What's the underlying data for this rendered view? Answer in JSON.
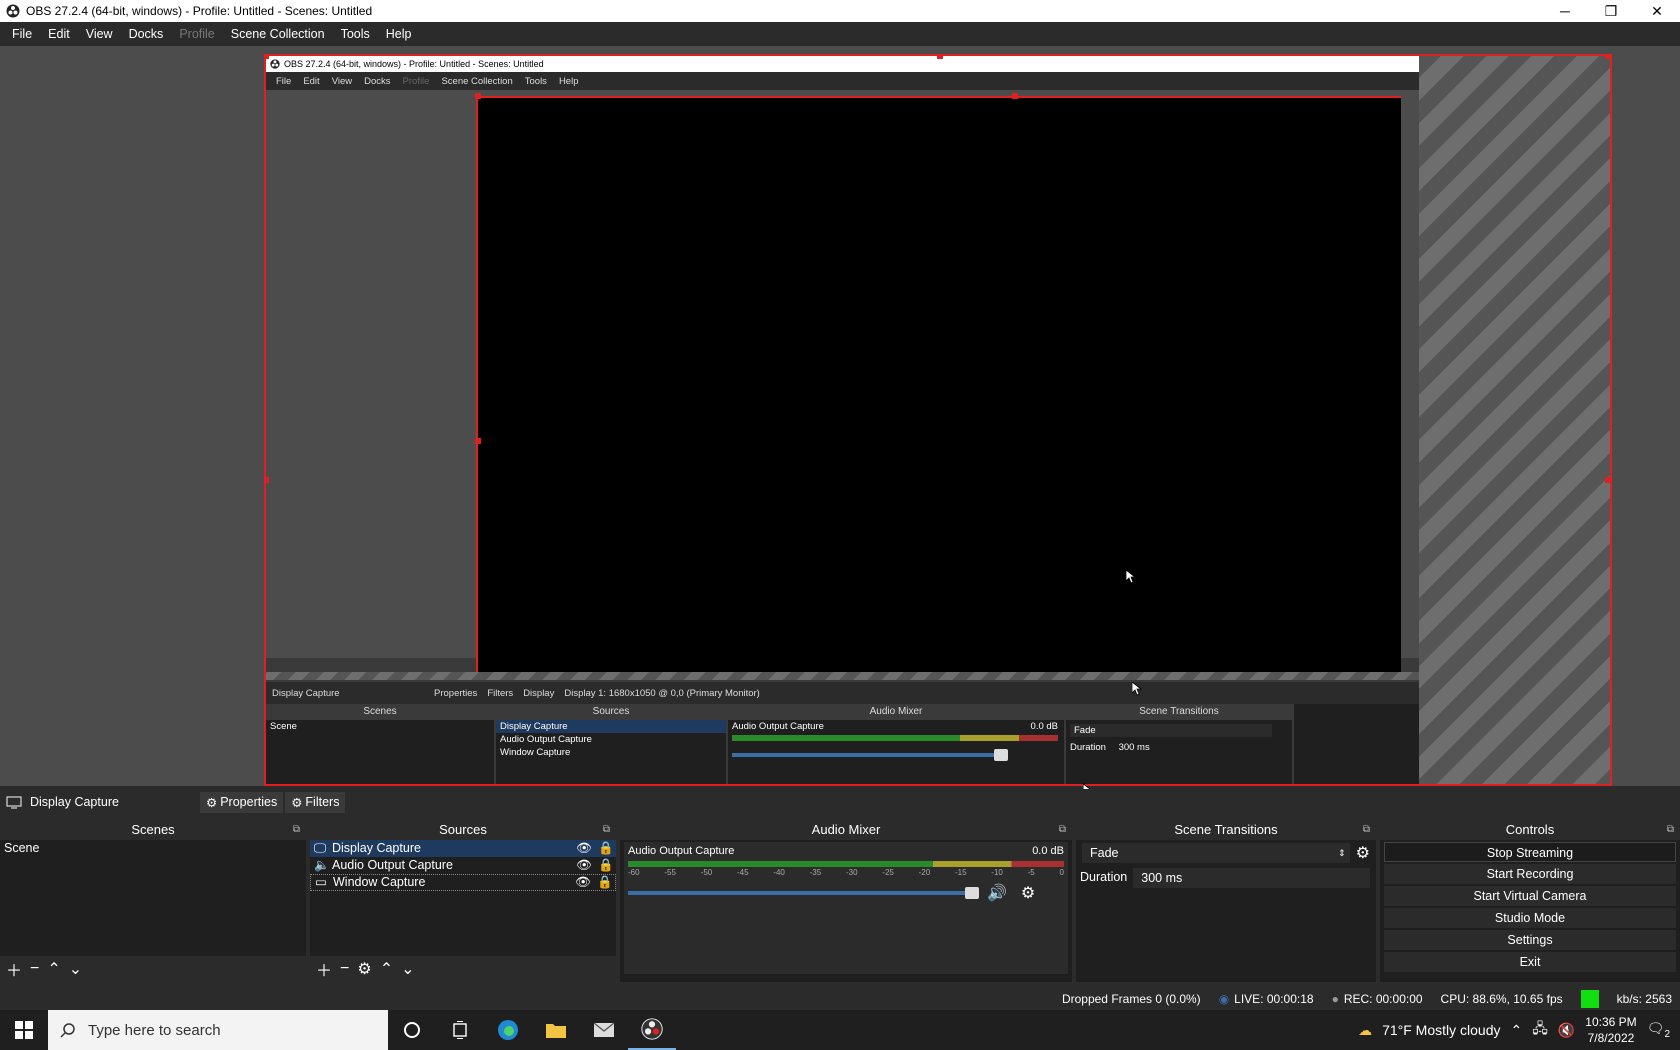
{
  "window": {
    "title": "OBS 27.2.4 (64-bit, windows) - Profile: Untitled - Scenes: Untitled",
    "minimize": "─",
    "restore": "❐",
    "close": "✕"
  },
  "menu": [
    "File",
    "Edit",
    "View",
    "Docks",
    "Profile",
    "Scene Collection",
    "Tools",
    "Help"
  ],
  "nested": {
    "title": "OBS 27.2.4 (64-bit, windows) - Profile: Untitled - Scenes: Untitled",
    "menu": [
      "File",
      "Edit",
      "View",
      "Docks",
      "Profile",
      "Scene Collection",
      "Tools",
      "Help"
    ],
    "source_name": "Display Capture",
    "properties": "Properties",
    "filters": "Filters",
    "display_label": "Display",
    "display_value": "Display 1: 1680x1050 @ 0,0 (Primary Monitor)",
    "scenes_header": "Scenes",
    "sources_header": "Sources",
    "mixer_header": "Audio Mixer",
    "transitions_header": "Scene Transitions",
    "scene": "Scene",
    "sources": [
      "Display Capture",
      "Audio Output Capture",
      "Window Capture"
    ],
    "mixer_source": "Audio Output Capture",
    "mixer_db": "0.0 dB",
    "transition": "Fade",
    "duration_label": "Duration",
    "duration_value": "300 ms"
  },
  "source_bar": {
    "name": "Display Capture",
    "properties": "Properties",
    "filters": "Filters"
  },
  "docks": {
    "scenes": {
      "header": "Scenes",
      "items": [
        "Scene"
      ]
    },
    "sources": {
      "header": "Sources",
      "items": [
        "Display Capture",
        "Audio Output Capture",
        "Window Capture"
      ]
    },
    "mixer": {
      "header": "Audio Mixer",
      "source": "Audio Output Capture",
      "db": "0.0 dB",
      "ticks": [
        "-60",
        "-55",
        "-50",
        "-45",
        "-40",
        "-35",
        "-30",
        "-25",
        "-20",
        "-15",
        "-10",
        "-5",
        "0"
      ],
      "volume": 1.0
    },
    "transitions": {
      "header": "Scene Transitions",
      "transition": "Fade",
      "duration_label": "Duration",
      "duration_value": "300 ms"
    },
    "controls": {
      "header": "Controls",
      "buttons": [
        "Stop Streaming",
        "Start Recording",
        "Start Virtual Camera",
        "Studio Mode",
        "Settings",
        "Exit"
      ]
    }
  },
  "status": {
    "dropped": "Dropped Frames 0 (0.0%)",
    "live": "LIVE: 00:00:18",
    "rec": "REC: 00:00:00",
    "cpu": "CPU: 88.6%, 10.65 fps",
    "kbs": "kb/s: 2563",
    "indicator_color": "#10e010"
  },
  "taskbar": {
    "search_placeholder": "Type here to search",
    "weather": "71°F  Mostly cloudy",
    "time": "10:36 PM",
    "date": "7/8/2022",
    "notifications": "2"
  },
  "colors": {
    "accent_red": "#e02020",
    "selection": "#1e3a5f",
    "panel": "#2b2b2b"
  }
}
